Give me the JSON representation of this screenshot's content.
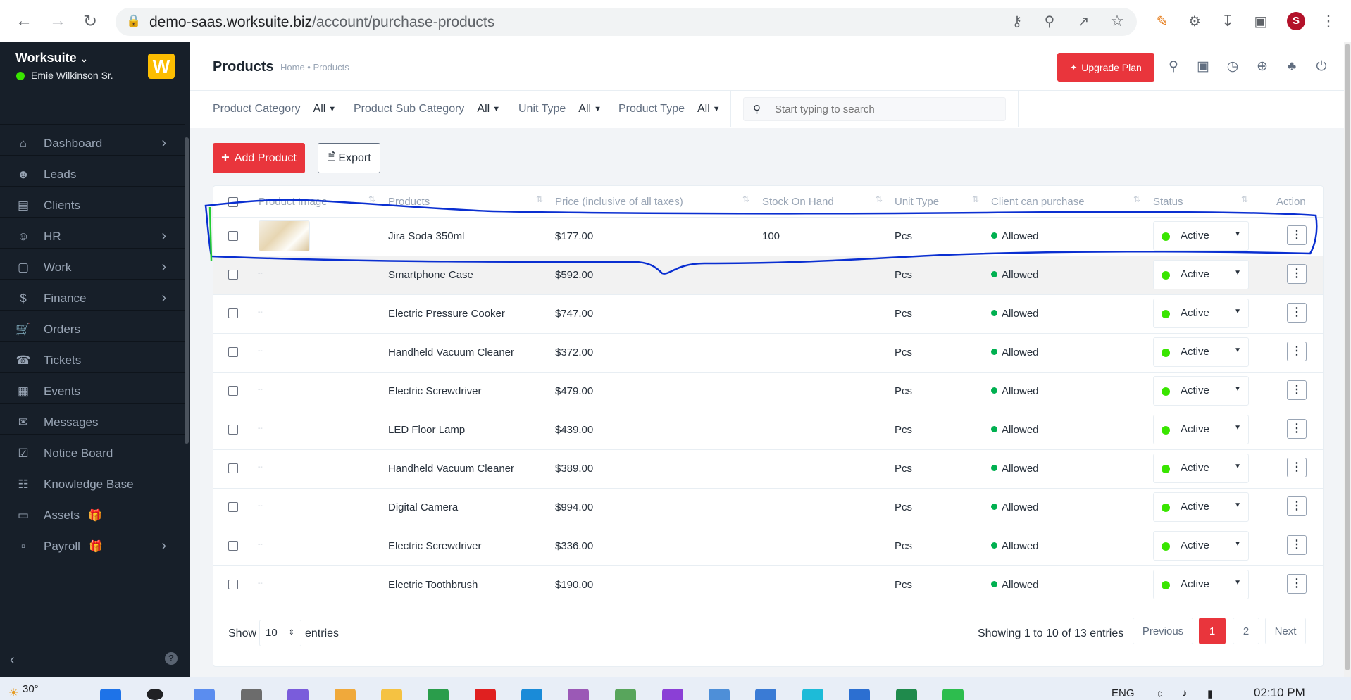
{
  "browser": {
    "url_host": "demo-saas.worksuite.biz",
    "url_path": "/account/purchase-products"
  },
  "sidebar": {
    "brand": "Worksuite",
    "user": "Emie Wilkinson Sr.",
    "logo_letter": "W",
    "items": [
      {
        "label": "Dashboard",
        "icon": "home-icon",
        "has_arrow": true
      },
      {
        "label": "Leads",
        "icon": "person-icon",
        "has_arrow": false
      },
      {
        "label": "Clients",
        "icon": "chart-icon",
        "has_arrow": false
      },
      {
        "label": "HR",
        "icon": "users-icon",
        "has_arrow": true
      },
      {
        "label": "Work",
        "icon": "briefcase-icon",
        "has_arrow": true
      },
      {
        "label": "Finance",
        "icon": "dollar-icon",
        "has_arrow": true
      },
      {
        "label": "Orders",
        "icon": "cart-icon",
        "has_arrow": false
      },
      {
        "label": "Tickets",
        "icon": "headset-icon",
        "has_arrow": false
      },
      {
        "label": "Events",
        "icon": "calendar-icon",
        "has_arrow": false
      },
      {
        "label": "Messages",
        "icon": "message-icon",
        "has_arrow": false
      },
      {
        "label": "Notice Board",
        "icon": "clipboard-icon",
        "has_arrow": false
      },
      {
        "label": "Knowledge Base",
        "icon": "book-icon",
        "has_arrow": false
      },
      {
        "label": "Assets",
        "icon": "monitor-icon",
        "has_arrow": false
      },
      {
        "label": "Payroll",
        "icon": "wallet-icon",
        "has_arrow": true
      }
    ]
  },
  "header": {
    "title": "Products",
    "breadcrumb": "Home • Products",
    "upgrade_label": "Upgrade Plan"
  },
  "filters": {
    "category_label": "Product Category",
    "category_value": "All",
    "subcategory_label": "Product Sub Category",
    "subcategory_value": "All",
    "unit_label": "Unit Type",
    "unit_value": "All",
    "type_label": "Product Type",
    "type_value": "All",
    "search_placeholder": "Start typing to search"
  },
  "actions": {
    "add_label": "Add Product",
    "export_label": "Export"
  },
  "table": {
    "headers": {
      "image": "Product Image",
      "products": "Products",
      "price": "Price (inclusive of all taxes)",
      "stock": "Stock On Hand",
      "unit": "Unit Type",
      "client": "Client can purchase",
      "status": "Status",
      "action": "Action"
    },
    "rows": [
      {
        "name": "Jira Soda 350ml",
        "price": "$177.00",
        "stock": "100",
        "unit": "Pcs",
        "client": "Allowed",
        "status": "Active",
        "image": "--"
      },
      {
        "name": "Smartphone Case",
        "price": "$592.00",
        "stock": "",
        "unit": "Pcs",
        "client": "Allowed",
        "status": "Active",
        "image": "--"
      },
      {
        "name": "Electric Pressure Cooker",
        "price": "$747.00",
        "stock": "",
        "unit": "Pcs",
        "client": "Allowed",
        "status": "Active",
        "image": "--"
      },
      {
        "name": "Handheld Vacuum Cleaner",
        "price": "$372.00",
        "stock": "",
        "unit": "Pcs",
        "client": "Allowed",
        "status": "Active",
        "image": "--"
      },
      {
        "name": "Electric Screwdriver",
        "price": "$479.00",
        "stock": "",
        "unit": "Pcs",
        "client": "Allowed",
        "status": "Active",
        "image": "--"
      },
      {
        "name": "LED Floor Lamp",
        "price": "$439.00",
        "stock": "",
        "unit": "Pcs",
        "client": "Allowed",
        "status": "Active",
        "image": "--"
      },
      {
        "name": "Handheld Vacuum Cleaner",
        "price": "$389.00",
        "stock": "",
        "unit": "Pcs",
        "client": "Allowed",
        "status": "Active",
        "image": "--"
      },
      {
        "name": "Digital Camera",
        "price": "$994.00",
        "stock": "",
        "unit": "Pcs",
        "client": "Allowed",
        "status": "Active",
        "image": "--"
      },
      {
        "name": "Electric Screwdriver",
        "price": "$336.00",
        "stock": "",
        "unit": "Pcs",
        "client": "Allowed",
        "status": "Active",
        "image": "--"
      },
      {
        "name": "Electric Toothbrush",
        "price": "$190.00",
        "stock": "",
        "unit": "Pcs",
        "client": "Allowed",
        "status": "Active",
        "image": "--"
      }
    ]
  },
  "footer": {
    "show_label": "Show",
    "entries_value": "10",
    "entries_label": "entries",
    "showing_text": "Showing 1 to 10 of 13 entries",
    "prev_label": "Previous",
    "pages": [
      "1",
      "2"
    ],
    "next_label": "Next"
  },
  "taskbar": {
    "temperature": "30°",
    "language": "ENG",
    "time": "02:10 PM"
  },
  "colors": {
    "accent": "#e9353c",
    "sidebar_bg": "#171f29",
    "status_green": "#39e500",
    "logo_yellow": "#fcbd01",
    "annotation_blue": "#0a2fd1"
  }
}
